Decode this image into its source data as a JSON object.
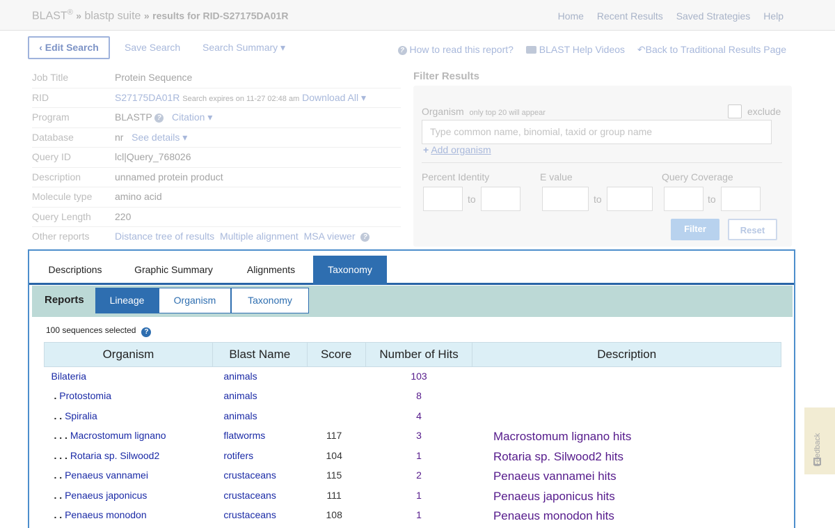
{
  "header": {
    "blast": "BLAST",
    "reg": "®",
    "sep1": "»",
    "suite": "blastp suite",
    "sep2": "»",
    "results": "results for RID-S27175DA01R",
    "nav": [
      "Home",
      "Recent Results",
      "Saved Strategies",
      "Help"
    ]
  },
  "toolbar": {
    "edit_search": "‹ Edit Search",
    "save_search": "Save Search",
    "search_summary": "Search Summary ▾",
    "how_to_read": "How to read this report?",
    "help_videos": "BLAST Help Videos",
    "back_traditional": "Back to Traditional Results Page"
  },
  "job": {
    "title_key": "Job Title",
    "title": "Protein Sequence",
    "rid_key": "RID",
    "rid": "S27175DA01R",
    "expires": "Search expires on 11-27 02:48 am",
    "download": "Download All ▾",
    "program_key": "Program",
    "program": "BLASTP",
    "citation": "Citation ▾",
    "database_key": "Database",
    "database": "nr",
    "see_details": "See details ▾",
    "query_id_key": "Query ID",
    "query_id": "lcl|Query_768026",
    "description_key": "Description",
    "description": "unnamed protein product",
    "molecule_key": "Molecule type",
    "molecule": "amino acid",
    "length_key": "Query Length",
    "length": "220",
    "other_key": "Other reports",
    "dist_tree": "Distance tree of results",
    "multi_align": "Multiple alignment",
    "msa_viewer": "MSA viewer"
  },
  "filter": {
    "title": "Filter Results",
    "organism": "Organism",
    "organism_note": "only top 20 will appear",
    "exclude": "exclude",
    "organism_placeholder": "Type common  name, binomial, taxid or group  name",
    "add_organism": "Add organism",
    "percent_identity": "Percent Identity",
    "evalue": "E value",
    "query_coverage": "Query Coverage",
    "to": "to",
    "filter_btn": "Filter",
    "reset_btn": "Reset"
  },
  "tabs": [
    "Descriptions",
    "Graphic Summary",
    "Alignments",
    "Taxonomy"
  ],
  "reports": {
    "label": "Reports",
    "buttons": [
      "Lineage",
      "Organism",
      "Taxonomy"
    ]
  },
  "selected": "100 sequences selected",
  "table": {
    "headers": [
      "Organism",
      "Blast Name",
      "Score",
      "Number of Hits",
      "Description"
    ],
    "rows": [
      {
        "dots": "",
        "organism": "Bilateria",
        "blast_name": "animals",
        "score": "",
        "hits": "103",
        "desc": ""
      },
      {
        "dots": ".",
        "organism": "Protostomia",
        "blast_name": "animals",
        "score": "",
        "hits": "8",
        "desc": ""
      },
      {
        "dots": ". .",
        "organism": "Spiralia",
        "blast_name": "animals",
        "score": "",
        "hits": "4",
        "desc": ""
      },
      {
        "dots": ". . .",
        "organism": "Macrostomum lignano",
        "blast_name": "flatworms",
        "score": "117",
        "hits": "3",
        "desc": "Macrostomum lignano hits"
      },
      {
        "dots": ". . .",
        "organism": "Rotaria sp. Silwood2",
        "blast_name": "rotifers",
        "score": "104",
        "hits": "1",
        "desc": "Rotaria sp. Silwood2 hits"
      },
      {
        "dots": ". .",
        "organism": "Penaeus vannamei",
        "blast_name": "crustaceans",
        "score": "115",
        "hits": "2",
        "desc": "Penaeus vannamei hits"
      },
      {
        "dots": ". .",
        "organism": "Penaeus japonicus",
        "blast_name": "crustaceans",
        "score": "111",
        "hits": "1",
        "desc": "Penaeus japonicus hits"
      },
      {
        "dots": ". .",
        "organism": "Penaeus monodon",
        "blast_name": "crustaceans",
        "score": "108",
        "hits": "1",
        "desc": "Penaeus monodon hits"
      }
    ]
  },
  "feedback": "Feedback"
}
